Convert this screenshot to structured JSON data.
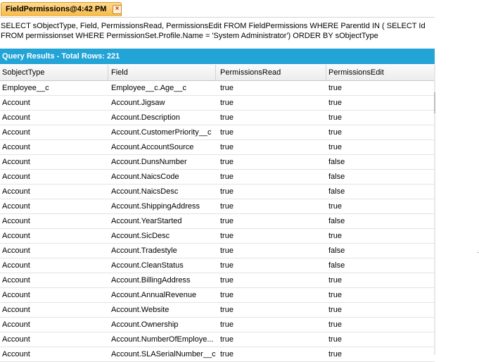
{
  "tab": {
    "label": "FieldPermissions@4:42 PM",
    "close": "×"
  },
  "query": "SELECT sObjectType, Field, PermissionsRead, PermissionsEdit FROM FieldPermissions WHERE ParentId IN ( SELECT Id FROM permissionset WHERE PermissionSet.Profile.Name = 'System Administrator') ORDER BY sObjectType",
  "results_header": "Query Results - Total Rows: 221",
  "columns": [
    "SobjectType",
    "Field",
    "PermissionsRead",
    "PermissionsEdit"
  ],
  "rows": [
    [
      "Employee__c",
      "Employee__c.Age__c",
      "true",
      "true"
    ],
    [
      "Account",
      "Account.Jigsaw",
      "true",
      "true"
    ],
    [
      "Account",
      "Account.Description",
      "true",
      "true"
    ],
    [
      "Account",
      "Account.CustomerPriority__c",
      "true",
      "true"
    ],
    [
      "Account",
      "Account.AccountSource",
      "true",
      "true"
    ],
    [
      "Account",
      "Account.DunsNumber",
      "true",
      "false"
    ],
    [
      "Account",
      "Account.NaicsCode",
      "true",
      "false"
    ],
    [
      "Account",
      "Account.NaicsDesc",
      "true",
      "false"
    ],
    [
      "Account",
      "Account.ShippingAddress",
      "true",
      "true"
    ],
    [
      "Account",
      "Account.YearStarted",
      "true",
      "false"
    ],
    [
      "Account",
      "Account.SicDesc",
      "true",
      "true"
    ],
    [
      "Account",
      "Account.Tradestyle",
      "true",
      "false"
    ],
    [
      "Account",
      "Account.CleanStatus",
      "true",
      "false"
    ],
    [
      "Account",
      "Account.BillingAddress",
      "true",
      "true"
    ],
    [
      "Account",
      "Account.AnnualRevenue",
      "true",
      "true"
    ],
    [
      "Account",
      "Account.Website",
      "true",
      "true"
    ],
    [
      "Account",
      "Account.Ownership",
      "true",
      "true"
    ],
    [
      "Account",
      "Account.NumberOfEmploye...",
      "true",
      "true"
    ],
    [
      "Account",
      "Account.SLASerialNumber__c",
      "true",
      "true"
    ]
  ]
}
